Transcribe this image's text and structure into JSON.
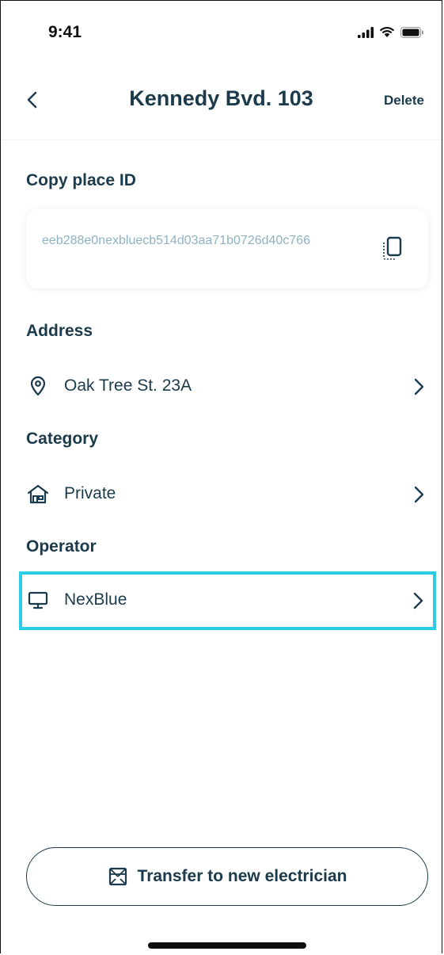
{
  "status_bar": {
    "time": "9:41",
    "icons": [
      "signal-icon",
      "wifi-icon",
      "battery-icon"
    ]
  },
  "header": {
    "back_icon": "chevron-left-icon",
    "title": "Kennedy Bvd. 103",
    "delete_label": "Delete"
  },
  "place_id": {
    "section_label": "Copy place ID",
    "value": "eeb288e0nexbluecb514d03aa71b0726d40c766",
    "copy_icon": "copy-icon"
  },
  "address": {
    "section_label": "Address",
    "value": "Oak Tree St. 23A",
    "icon": "location-pin-icon"
  },
  "category": {
    "section_label": "Category",
    "value": "Private",
    "icon": "house-icon"
  },
  "operator": {
    "section_label": "Operator",
    "value": "NexBlue",
    "icon": "monitor-icon",
    "highlighted": true,
    "highlight_color": "#2ccbe8"
  },
  "footer": {
    "transfer_label": "Transfer to new electrician",
    "transfer_icon": "transfer-box-icon"
  },
  "colors": {
    "text_primary": "#1b3a4b",
    "text_muted": "#8fb2c1",
    "highlight": "#2ccbe8"
  }
}
